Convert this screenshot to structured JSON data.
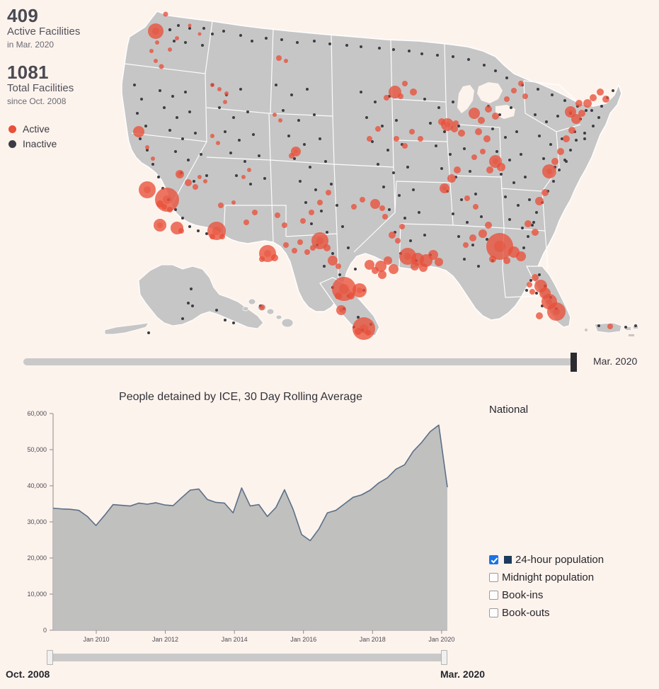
{
  "theme": {
    "background": "#fdf3ed",
    "active_color": "#e8503a",
    "inactive_color": "#3c3c44",
    "land_color": "#c6c6c6",
    "border_color": "#ffffff",
    "line_color": "#5b7086",
    "area_color": "#bdbdbd",
    "checkbox_on": "#1a73e8",
    "series_swatch": "#1d3b5c",
    "slider_track": "#c9c9c9",
    "slider_handle": "#2b2b30"
  },
  "stats": {
    "active_count": "409",
    "active_label": "Active Facilities",
    "active_sub": "in Mar. 2020",
    "total_count": "1081",
    "total_label": "Total Facilities",
    "total_sub": "since Oct. 2008"
  },
  "map_legend": [
    {
      "label": "Active",
      "color": "#e8503a"
    },
    {
      "label": "Inactive",
      "color": "#3c3c44"
    }
  ],
  "map_slider": {
    "current_label": "Mar. 2020",
    "position_pct": 99
  },
  "side_panel": {
    "scope_label": "National"
  },
  "series_checkboxes": [
    {
      "label": "24-hour population",
      "checked": true,
      "swatch": "#1d3b5c"
    },
    {
      "label": "Midnight population",
      "checked": false,
      "swatch": null
    },
    {
      "label": "Book-ins",
      "checked": false,
      "swatch": null
    },
    {
      "label": "Book-outs",
      "checked": false,
      "swatch": null
    }
  ],
  "range_slider": {
    "start_label": "Oct. 2008",
    "end_label": "Mar. 2020"
  },
  "chart_data": {
    "type": "area",
    "title": "People detained by ICE, 30 Day Rolling Average",
    "xlabel": "",
    "ylabel": "",
    "ylim": [
      0,
      60000
    ],
    "grid": false,
    "legend_position": "right",
    "ytick_labels": [
      "0",
      "10,000",
      "20,000",
      "30,000",
      "40,000",
      "50,000",
      "60,000"
    ],
    "ytick_values": [
      0,
      10000,
      20000,
      30000,
      40000,
      50000,
      60000
    ],
    "xtick_labels": [
      "Jan 2010",
      "Jan 2012",
      "Jan 2014",
      "Jan 2016",
      "Jan 2018",
      "Jan 2020"
    ],
    "xtick_values": [
      "2010-01",
      "2012-01",
      "2014-01",
      "2016-01",
      "2018-01",
      "2020-01"
    ],
    "x_range": [
      "2008-10",
      "2020-03"
    ],
    "series": [
      {
        "name": "24-hour population",
        "color": "#5b7086",
        "x": [
          "2008-10",
          "2009-01",
          "2009-04",
          "2009-07",
          "2009-10",
          "2010-01",
          "2010-04",
          "2010-07",
          "2010-10",
          "2011-01",
          "2011-04",
          "2011-07",
          "2011-10",
          "2012-01",
          "2012-04",
          "2012-07",
          "2012-10",
          "2013-01",
          "2013-04",
          "2013-07",
          "2013-10",
          "2014-01",
          "2014-04",
          "2014-07",
          "2014-10",
          "2015-01",
          "2015-04",
          "2015-07",
          "2015-10",
          "2016-01",
          "2016-04",
          "2016-07",
          "2016-10",
          "2017-01",
          "2017-04",
          "2017-07",
          "2017-10",
          "2018-01",
          "2018-04",
          "2018-07",
          "2018-10",
          "2019-01",
          "2019-04",
          "2019-07",
          "2019-10",
          "2020-01",
          "2020-03"
        ],
        "values": [
          33800,
          33600,
          33500,
          33200,
          31500,
          29000,
          31800,
          34800,
          34600,
          34400,
          35200,
          34900,
          35300,
          34700,
          34500,
          36700,
          38800,
          39100,
          36200,
          35400,
          35200,
          32500,
          39400,
          34400,
          34800,
          31500,
          34000,
          38900,
          33500,
          26500,
          24800,
          28000,
          32500,
          33200,
          35000,
          36800,
          37500,
          38800,
          40800,
          42200,
          44600,
          45800,
          49500,
          52000,
          55000,
          56800,
          39600
        ]
      }
    ]
  }
}
